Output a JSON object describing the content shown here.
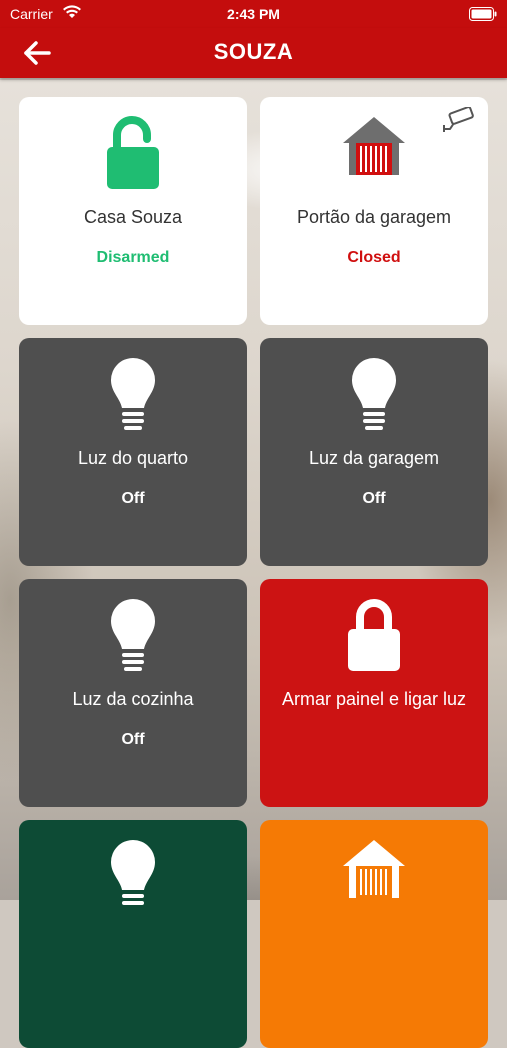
{
  "status_bar": {
    "carrier": "Carrier",
    "time": "2:43 PM"
  },
  "header": {
    "title": "SOUZA"
  },
  "colors": {
    "brand_red": "#c40d0d",
    "disarmed_green": "#1fbd72",
    "closed_red": "#d00f0f",
    "tile_gray": "#4f4f4f",
    "tile_dark_green": "#0d4b35",
    "tile_orange": "#f57a05"
  },
  "tiles": [
    {
      "label": "Casa Souza",
      "status": "Disarmed",
      "icon": "lock-open-icon"
    },
    {
      "label": "Portão da garagem",
      "status": "Closed",
      "icon": "garage-icon",
      "extra_icon": "camera-icon"
    },
    {
      "label": "Luz do quarto",
      "status": "Off",
      "icon": "lightbulb-icon"
    },
    {
      "label": "Luz da garagem",
      "status": "Off",
      "icon": "lightbulb-icon"
    },
    {
      "label": "Luz da cozinha",
      "status": "Off",
      "icon": "lightbulb-icon"
    },
    {
      "label": "Armar painel e ligar luz",
      "icon": "lock-closed-icon"
    },
    {
      "icon": "lightbulb-icon"
    },
    {
      "icon": "garage-icon"
    }
  ]
}
